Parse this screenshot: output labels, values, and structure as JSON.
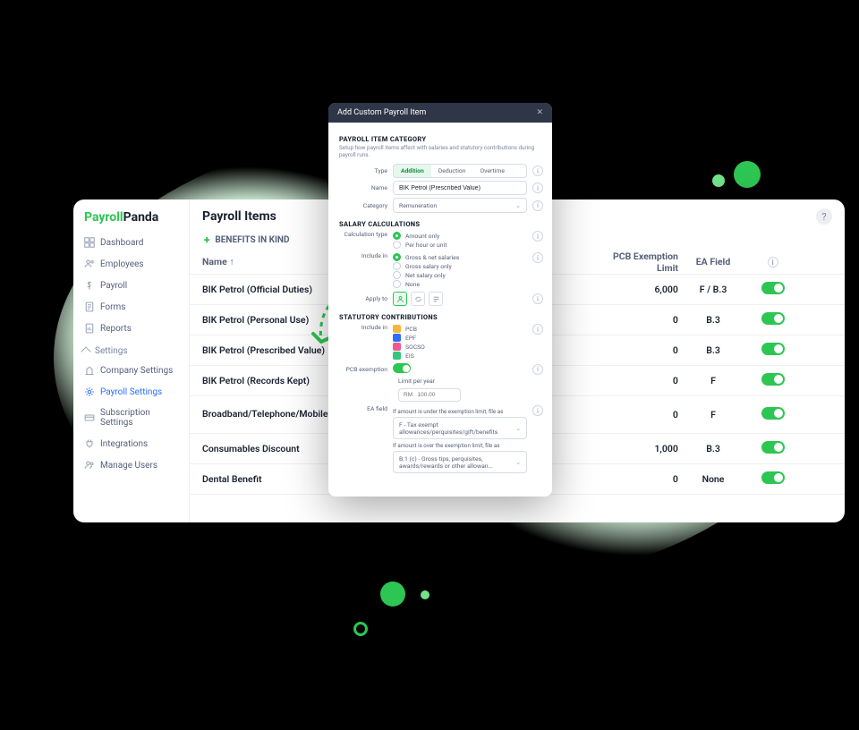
{
  "brand": {
    "part1": "Payroll",
    "part2": "Panda"
  },
  "sidebar": {
    "items": [
      {
        "label": "Dashboard"
      },
      {
        "label": "Employees"
      },
      {
        "label": "Payroll"
      },
      {
        "label": "Forms"
      },
      {
        "label": "Reports"
      }
    ],
    "settings_header": "Settings",
    "settings": [
      {
        "label": "Company Settings"
      },
      {
        "label": "Payroll Settings"
      },
      {
        "label": "Subscription Settings"
      },
      {
        "label": "Integrations"
      },
      {
        "label": "Manage Users"
      }
    ]
  },
  "page": {
    "title": "Payroll Items",
    "subtitle": "BENEFITS IN KIND"
  },
  "table": {
    "headers": {
      "name": "Name",
      "pcb": "PCB Exemption Limit",
      "ea": "EA Field"
    },
    "rows": [
      {
        "name": "BIK Petrol (Official Duties)",
        "pcb": "6,000",
        "ea": "F / B.3"
      },
      {
        "name": "BIK Petrol (Personal Use)",
        "pcb": "0",
        "ea": "B.3"
      },
      {
        "name": "BIK Petrol (Prescribed Value)",
        "pcb": "0",
        "ea": "B.3"
      },
      {
        "name": "BIK Petrol (Records Kept)",
        "pcb": "0",
        "ea": "F"
      },
      {
        "name": "Broadband/Telephone/Mobile Plans (Paid By Employer)",
        "pcb": "0",
        "ea": "F"
      },
      {
        "name": "Consumables Discount",
        "pcb": "1,000",
        "ea": "B.3"
      },
      {
        "name": "Dental Benefit",
        "pcb": "0",
        "ea": "None"
      }
    ]
  },
  "modal": {
    "title": "Add Custom Payroll Item",
    "cat_section": "PAYROLL ITEM CATEGORY",
    "cat_desc": "Setup how payroll items affect with salaries and statutory contributions during payroll runs.",
    "type_label": "Type",
    "type_opts": [
      "Addition",
      "Deduction",
      "Overtime"
    ],
    "name_label": "Name",
    "name_value": "BIK Petrol (Prescribed Value)",
    "category_label": "Category",
    "category_value": "Remuneration",
    "salary_section": "SALARY CALCULATIONS",
    "calc_label": "Calculation type",
    "calc_opts": [
      "Amount only",
      "Per hour or unit"
    ],
    "include_label": "Include in",
    "include_opts": [
      "Gross & net salaries",
      "Gross salary only",
      "Net salary only",
      "None"
    ],
    "apply_label": "Apply to",
    "statutory_section": "STATUTORY CONTRIBUTIONS",
    "stat_include_label": "Include in",
    "stat_items": [
      {
        "label": "PCB",
        "color": "#f4b63f"
      },
      {
        "label": "EPF",
        "color": "#2f6dff"
      },
      {
        "label": "SOCSO",
        "color": "#ef5a8f"
      },
      {
        "label": "EIS",
        "color": "#32c77f"
      }
    ],
    "pcb_ex_label": "PCB exemption",
    "limit_label": "Limit per year",
    "limit_placeholder": "RM   100.00",
    "ea_field_label": "EA field",
    "ea_under_lbl": "If amount is under the exemption limit, file as",
    "ea_under_val": "F - Tax exempt allowances/perquisites/gift/benefits",
    "ea_over_lbl": "If amount is over the exemption limit, file as",
    "ea_over_val": "B.1 (c) - Gross tips, perquisites, awards/rewards or other allowan..."
  }
}
